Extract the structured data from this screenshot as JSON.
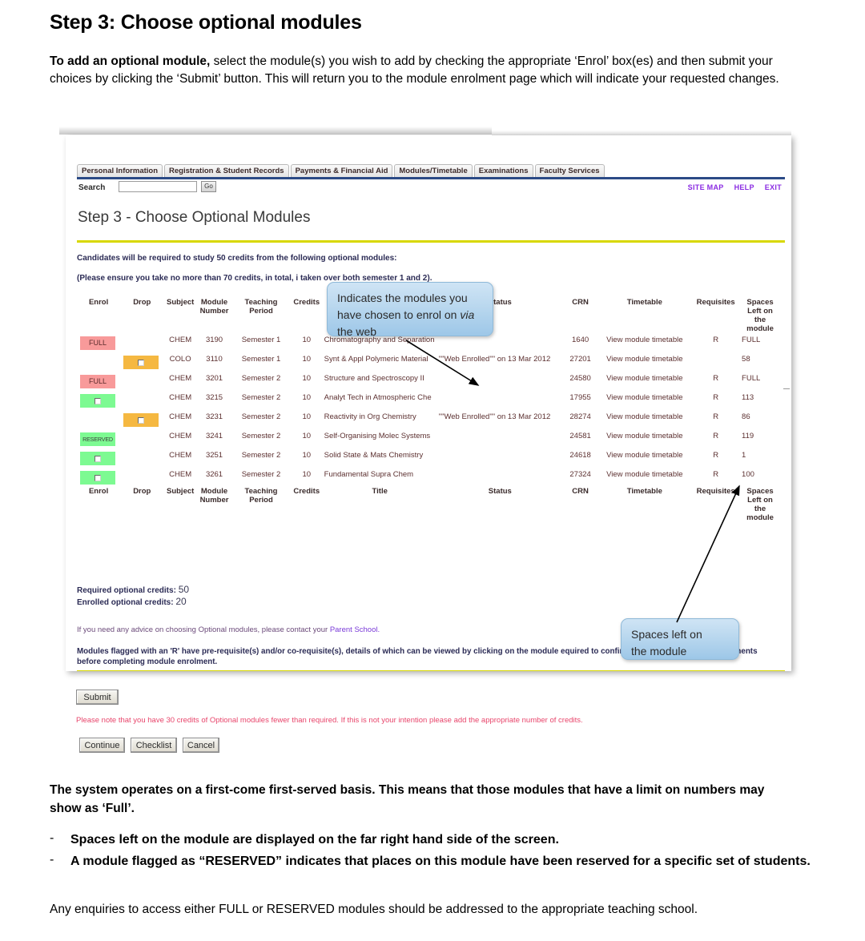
{
  "document": {
    "title": "Step 3: Choose optional modules",
    "intro_bold": "To add an optional module,",
    "intro_rest": " select the module(s) you wish to add by checking the appropriate ‘Enrol’ box(es) and then submit your choices by clicking the ‘Submit’ button. This will return you to the module enrolment page which will indicate your requested changes.",
    "closing_bold": "The system operates on a first-come first-served basis. This means that those modules that have a limit on numbers may show as ‘Full’.",
    "bullets": [
      {
        "dash": "-",
        "text": "Spaces left on the module are displayed on the far right hand side of the screen."
      },
      {
        "dash": "-",
        "text": "A module flagged as “RESERVED” indicates that places on this module have been reserved for a specific set of students."
      }
    ],
    "final_para": "Any enquiries to access either FULL or RESERVED modules should be addressed to the appropriate teaching school."
  },
  "screenshot": {
    "tabs": [
      "Personal Information",
      "Registration & Student Records",
      "Payments & Financial Aid",
      "Modules/Timetable",
      "Examinations",
      "Faculty Services"
    ],
    "search": {
      "label": "Search",
      "value": "",
      "placeholder": "",
      "go_label": "Go"
    },
    "top_links": [
      "SITE MAP",
      "HELP",
      "EXIT"
    ],
    "page_title": "Step 3 - Choose Optional Modules",
    "candidates_line": "Candidates will be required to study 50 credits from the following optional modules:",
    "note_line": "(Please ensure you take no more than 70 credits, in total, i                                        taken over both semester 1 and 2).",
    "table": {
      "headers": [
        "Enrol",
        "Drop",
        "Subject",
        "Module Number",
        "Teaching Period",
        "Credits",
        "Title",
        "Status",
        "CRN",
        "Timetable",
        "Requisites",
        "Spaces Left on the module"
      ],
      "footer_headers": [
        "Enrol",
        "Drop",
        "Subject",
        "Module Number",
        "Teaching Period",
        "Credits",
        "Title",
        "Status",
        "CRN",
        "Timetable",
        "Requisites",
        "Spaces Left on the module"
      ],
      "timetable_link_label": "View module timetable",
      "rows": [
        {
          "enrol": "FULL",
          "enrol_type": "full",
          "drop": "",
          "drop_type": "none",
          "subject": "CHEM",
          "number": "3190",
          "period": "Semester 1",
          "credits": "10",
          "title": "Chromatography and Separation",
          "status": "",
          "crn": "1640",
          "timetable": "View module timetable",
          "requisites": "R",
          "spaces": "FULL"
        },
        {
          "enrol": "",
          "enrol_type": "none",
          "drop": "",
          "drop_type": "checkbox-orange",
          "subject": "COLO",
          "number": "3110",
          "period": "Semester 1",
          "credits": "10",
          "title": "Synt & Appl Polymeric Material",
          "status": "\"\"Web Enrolled\"\" on 13 Mar 2012",
          "crn": "27201",
          "timetable": "View module timetable",
          "requisites": "",
          "spaces": "58"
        },
        {
          "enrol": "FULL",
          "enrol_type": "full",
          "drop": "",
          "drop_type": "none",
          "subject": "CHEM",
          "number": "3201",
          "period": "Semester 2",
          "credits": "10",
          "title": "Structure and Spectroscopy II",
          "status": "",
          "crn": "24580",
          "timetable": "View module timetable",
          "requisites": "R",
          "spaces": "FULL"
        },
        {
          "enrol": "",
          "enrol_type": "checkbox-green",
          "drop": "",
          "drop_type": "none",
          "subject": "CHEM",
          "number": "3215",
          "period": "Semester 2",
          "credits": "10",
          "title": "Analyt Tech in Atmospheric Che",
          "status": "",
          "crn": "17955",
          "timetable": "View module timetable",
          "requisites": "R",
          "spaces": "113"
        },
        {
          "enrol": "",
          "enrol_type": "none",
          "drop": "",
          "drop_type": "checkbox-orange",
          "subject": "CHEM",
          "number": "3231",
          "period": "Semester 2",
          "credits": "10",
          "title": "Reactivity in Org Chemistry",
          "status": "\"\"Web Enrolled\"\" on 13 Mar 2012",
          "crn": "28274",
          "timetable": "View module timetable",
          "requisites": "R",
          "spaces": "86"
        },
        {
          "enrol": "RESERVED",
          "enrol_type": "reserved",
          "drop": "",
          "drop_type": "none",
          "subject": "CHEM",
          "number": "3241",
          "period": "Semester 2",
          "credits": "10",
          "title": "Self-Organising Molec Systems",
          "status": "",
          "crn": "24581",
          "timetable": "View module timetable",
          "requisites": "R",
          "spaces": "119"
        },
        {
          "enrol": "",
          "enrol_type": "checkbox-green",
          "drop": "",
          "drop_type": "none",
          "subject": "CHEM",
          "number": "3251",
          "period": "Semester 2",
          "credits": "10",
          "title": "Solid State & Mats Chemistry",
          "status": "",
          "crn": "24618",
          "timetable": "View module timetable",
          "requisites": "R",
          "spaces": "1"
        },
        {
          "enrol": "",
          "enrol_type": "checkbox-green",
          "drop": "",
          "drop_type": "none",
          "subject": "CHEM",
          "number": "3261",
          "period": "Semester 2",
          "credits": "10",
          "title": "Fundamental Supra Chem",
          "status": "",
          "crn": "27324",
          "timetable": "View module timetable",
          "requisites": "R",
          "spaces": "100"
        }
      ]
    },
    "summary": {
      "required_label": "Required optional credits:",
      "required_value": "50",
      "enrolled_label": "Enrolled optional credits:",
      "enrolled_value": "20"
    },
    "advice_text": "If you need any advice on choosing Optional modules, please contact your ",
    "advice_link": "Parent School.",
    "requisite_note": "Modules flagged with an 'R' have pre-requisite(s) and/or co-requisite(s), details of which can be viewed by clicking on the module                     equired to confirm that you meet these requirements before completing module enrolment.",
    "buttons": {
      "submit": "Submit",
      "continue": "Continue",
      "checklist": "Checklist",
      "cancel": "Cancel"
    },
    "warning": "Please note that you have 30 credits of Optional modules fewer than required. If this is not your intention please add the appropriate number of credits."
  },
  "callouts": {
    "one_a": "Indicates the modules you",
    "one_b": "have chosen to enrol on ",
    "one_italic": "via",
    "one_c": "the web",
    "two_a": "Spaces left on",
    "two_b": "the module"
  },
  "colors": {
    "full": "#f89a9a",
    "available": "#7dfa92",
    "drop": "#f5b841",
    "rule": "#d8d800",
    "nav_underline": "#2b4a86",
    "link": "#6a3ad8",
    "warning": "#e8456b",
    "callout": "#bcd9ef"
  }
}
